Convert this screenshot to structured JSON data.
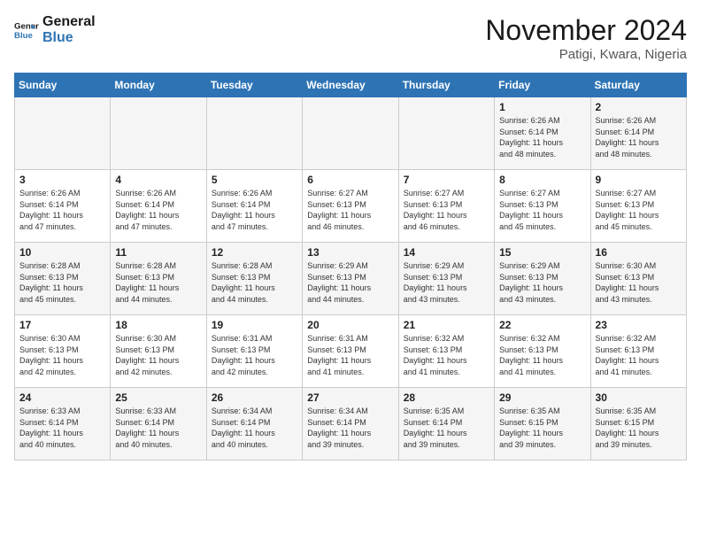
{
  "header": {
    "logo_line1": "General",
    "logo_line2": "Blue",
    "month": "November 2024",
    "location": "Patigi, Kwara, Nigeria"
  },
  "days_of_week": [
    "Sunday",
    "Monday",
    "Tuesday",
    "Wednesday",
    "Thursday",
    "Friday",
    "Saturday"
  ],
  "weeks": [
    [
      {
        "day": "",
        "info": ""
      },
      {
        "day": "",
        "info": ""
      },
      {
        "day": "",
        "info": ""
      },
      {
        "day": "",
        "info": ""
      },
      {
        "day": "",
        "info": ""
      },
      {
        "day": "1",
        "info": "Sunrise: 6:26 AM\nSunset: 6:14 PM\nDaylight: 11 hours\nand 48 minutes."
      },
      {
        "day": "2",
        "info": "Sunrise: 6:26 AM\nSunset: 6:14 PM\nDaylight: 11 hours\nand 48 minutes."
      }
    ],
    [
      {
        "day": "3",
        "info": "Sunrise: 6:26 AM\nSunset: 6:14 PM\nDaylight: 11 hours\nand 47 minutes."
      },
      {
        "day": "4",
        "info": "Sunrise: 6:26 AM\nSunset: 6:14 PM\nDaylight: 11 hours\nand 47 minutes."
      },
      {
        "day": "5",
        "info": "Sunrise: 6:26 AM\nSunset: 6:14 PM\nDaylight: 11 hours\nand 47 minutes."
      },
      {
        "day": "6",
        "info": "Sunrise: 6:27 AM\nSunset: 6:13 PM\nDaylight: 11 hours\nand 46 minutes."
      },
      {
        "day": "7",
        "info": "Sunrise: 6:27 AM\nSunset: 6:13 PM\nDaylight: 11 hours\nand 46 minutes."
      },
      {
        "day": "8",
        "info": "Sunrise: 6:27 AM\nSunset: 6:13 PM\nDaylight: 11 hours\nand 45 minutes."
      },
      {
        "day": "9",
        "info": "Sunrise: 6:27 AM\nSunset: 6:13 PM\nDaylight: 11 hours\nand 45 minutes."
      }
    ],
    [
      {
        "day": "10",
        "info": "Sunrise: 6:28 AM\nSunset: 6:13 PM\nDaylight: 11 hours\nand 45 minutes."
      },
      {
        "day": "11",
        "info": "Sunrise: 6:28 AM\nSunset: 6:13 PM\nDaylight: 11 hours\nand 44 minutes."
      },
      {
        "day": "12",
        "info": "Sunrise: 6:28 AM\nSunset: 6:13 PM\nDaylight: 11 hours\nand 44 minutes."
      },
      {
        "day": "13",
        "info": "Sunrise: 6:29 AM\nSunset: 6:13 PM\nDaylight: 11 hours\nand 44 minutes."
      },
      {
        "day": "14",
        "info": "Sunrise: 6:29 AM\nSunset: 6:13 PM\nDaylight: 11 hours\nand 43 minutes."
      },
      {
        "day": "15",
        "info": "Sunrise: 6:29 AM\nSunset: 6:13 PM\nDaylight: 11 hours\nand 43 minutes."
      },
      {
        "day": "16",
        "info": "Sunrise: 6:30 AM\nSunset: 6:13 PM\nDaylight: 11 hours\nand 43 minutes."
      }
    ],
    [
      {
        "day": "17",
        "info": "Sunrise: 6:30 AM\nSunset: 6:13 PM\nDaylight: 11 hours\nand 42 minutes."
      },
      {
        "day": "18",
        "info": "Sunrise: 6:30 AM\nSunset: 6:13 PM\nDaylight: 11 hours\nand 42 minutes."
      },
      {
        "day": "19",
        "info": "Sunrise: 6:31 AM\nSunset: 6:13 PM\nDaylight: 11 hours\nand 42 minutes."
      },
      {
        "day": "20",
        "info": "Sunrise: 6:31 AM\nSunset: 6:13 PM\nDaylight: 11 hours\nand 41 minutes."
      },
      {
        "day": "21",
        "info": "Sunrise: 6:32 AM\nSunset: 6:13 PM\nDaylight: 11 hours\nand 41 minutes."
      },
      {
        "day": "22",
        "info": "Sunrise: 6:32 AM\nSunset: 6:13 PM\nDaylight: 11 hours\nand 41 minutes."
      },
      {
        "day": "23",
        "info": "Sunrise: 6:32 AM\nSunset: 6:13 PM\nDaylight: 11 hours\nand 41 minutes."
      }
    ],
    [
      {
        "day": "24",
        "info": "Sunrise: 6:33 AM\nSunset: 6:14 PM\nDaylight: 11 hours\nand 40 minutes."
      },
      {
        "day": "25",
        "info": "Sunrise: 6:33 AM\nSunset: 6:14 PM\nDaylight: 11 hours\nand 40 minutes."
      },
      {
        "day": "26",
        "info": "Sunrise: 6:34 AM\nSunset: 6:14 PM\nDaylight: 11 hours\nand 40 minutes."
      },
      {
        "day": "27",
        "info": "Sunrise: 6:34 AM\nSunset: 6:14 PM\nDaylight: 11 hours\nand 39 minutes."
      },
      {
        "day": "28",
        "info": "Sunrise: 6:35 AM\nSunset: 6:14 PM\nDaylight: 11 hours\nand 39 minutes."
      },
      {
        "day": "29",
        "info": "Sunrise: 6:35 AM\nSunset: 6:15 PM\nDaylight: 11 hours\nand 39 minutes."
      },
      {
        "day": "30",
        "info": "Sunrise: 6:35 AM\nSunset: 6:15 PM\nDaylight: 11 hours\nand 39 minutes."
      }
    ]
  ]
}
